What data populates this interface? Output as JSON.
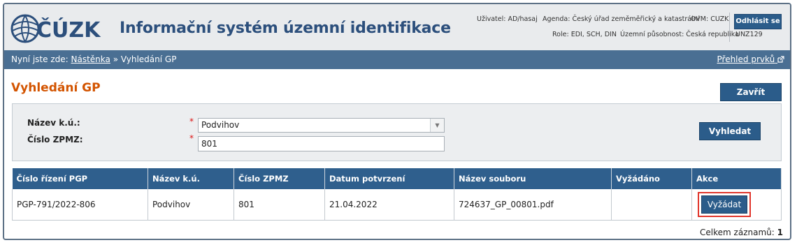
{
  "header": {
    "logo_text": "ČÚZK",
    "app_title": "Informační systém územní identifikace",
    "user_label": "Uživatel: AD/hasaj",
    "agenda_label": "Agenda: Český úřad zeměměřický a katastrální",
    "ovm_label": "OVM: CUZK",
    "role_label": "Role: EDI, SCH, DIN",
    "scope_label": "Územní působnost: Česká republika",
    "unz_label": "UNZ129",
    "logout_label": "Odhlásit se"
  },
  "breadcrumb": {
    "prefix": "Nyní jste zde:",
    "home": "Nástěnka",
    "separator": "»",
    "current": "Vyhledání GP",
    "overview_link": "Přehled prvků"
  },
  "page": {
    "title": "Vyhledání GP",
    "close_label": "Zavřít"
  },
  "search": {
    "ku_label": "Název k.ú.:",
    "ku_value": "Podvihov",
    "zpmz_label": "Číslo ZPMZ:",
    "zpmz_value": "801",
    "required_mark": "*",
    "search_label": "Vyhledat"
  },
  "table": {
    "columns": [
      "Číslo řízení PGP",
      "Název k.ú.",
      "Číslo ZPMZ",
      "Datum potvrzení",
      "Název souboru",
      "Vyžádáno",
      "Akce"
    ],
    "rows": [
      {
        "pgp": "PGP-791/2022-806",
        "ku": "Podvihov",
        "zpmz": "801",
        "date": "21.04.2022",
        "file": "724637_GP_00801.pdf",
        "requested": "",
        "action": "Vyžádat"
      }
    ]
  },
  "footer": {
    "total_label": "Celkem záznamů:",
    "total_value": "1"
  },
  "colors": {
    "accent": "#2b5c8a",
    "title_orange": "#d35400",
    "highlight": "#e0352b"
  }
}
